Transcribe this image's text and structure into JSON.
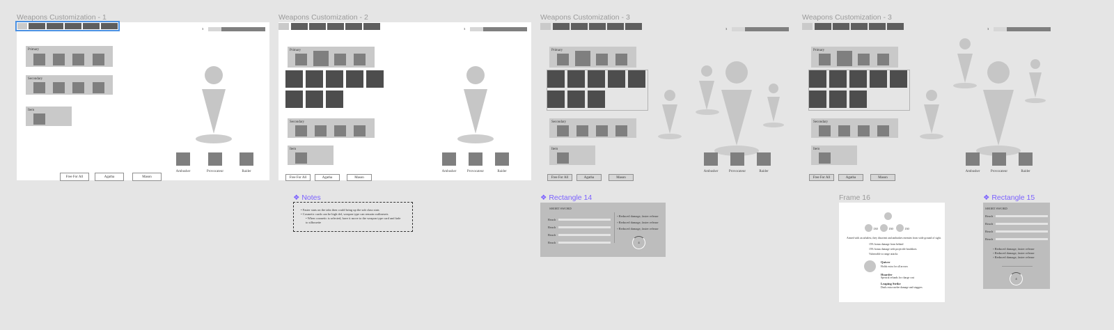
{
  "frames": [
    {
      "title": "Weapons Customization - 1"
    },
    {
      "title": "Weapons Customization - 2"
    },
    {
      "title": "Weapons Customization - 3"
    },
    {
      "title": "Weapons Customization - 3"
    }
  ],
  "counter": "3",
  "sections": {
    "primary": "Primary",
    "secondary": "Secondary",
    "item": "Item"
  },
  "modes": [
    "Free For All",
    "Agatha",
    "Mason"
  ],
  "slots": [
    "Ambusher",
    "Provocateur",
    "Raider"
  ],
  "components": {
    "notes": "Notes",
    "rect14": "Rectangle 14",
    "frame16": "Frame 16",
    "rect15": "Rectangle 15"
  },
  "notes": {
    "bullets": [
      "Faster stats on the tabs then could bring up the sub class stats",
      "Cosmetic cards can be high def, weapon type can remain outlinesets"
    ],
    "sub_bullet": "When cosmetic is selected, have it move to the weapon type card and fade to silhouette"
  },
  "stat_tweaks": {
    "title": "SHORT SWORD",
    "rows": [
      "Reach",
      "Reach",
      "Reach",
      "Reach"
    ],
    "options": [
      "Reduced damage, faster release",
      "Reduced damage, faster release",
      "Reduced damage, faster release"
    ],
    "dial_value": "4"
  },
  "frame16": {
    "stats": [
      "130",
      "130",
      "130"
    ],
    "description": "Armed with an arbalest, they disorient and ambushes enemies from wide ground of sight.",
    "bullets": [
      "15% bonus damage from behind",
      "15% bonus damage with projectile headshots",
      "Vulnerable to range attacks"
    ],
    "abilities": [
      {
        "name": "Quiver",
        "desc": "Holds extra for all arrows"
      },
      {
        "name": "Hoarder",
        "desc": "Spectral refunds for charge cost"
      },
      {
        "name": "Leaping Strike",
        "desc": "Deals extra melee damage and staggers"
      }
    ]
  },
  "stat_tweaks_2": {
    "title": "SHORT SWORD",
    "rows": [
      "Reach",
      "Reach",
      "Reach",
      "Reach"
    ],
    "options": [
      "Reduced damage, faster release",
      "Reduced damage, faster release",
      "Reduced damage, faster release"
    ],
    "dial_value": "4"
  },
  "colors": {
    "accent": "#7b61ff",
    "selection": "#4a90e2",
    "frame_title": "#9a9a9a"
  }
}
